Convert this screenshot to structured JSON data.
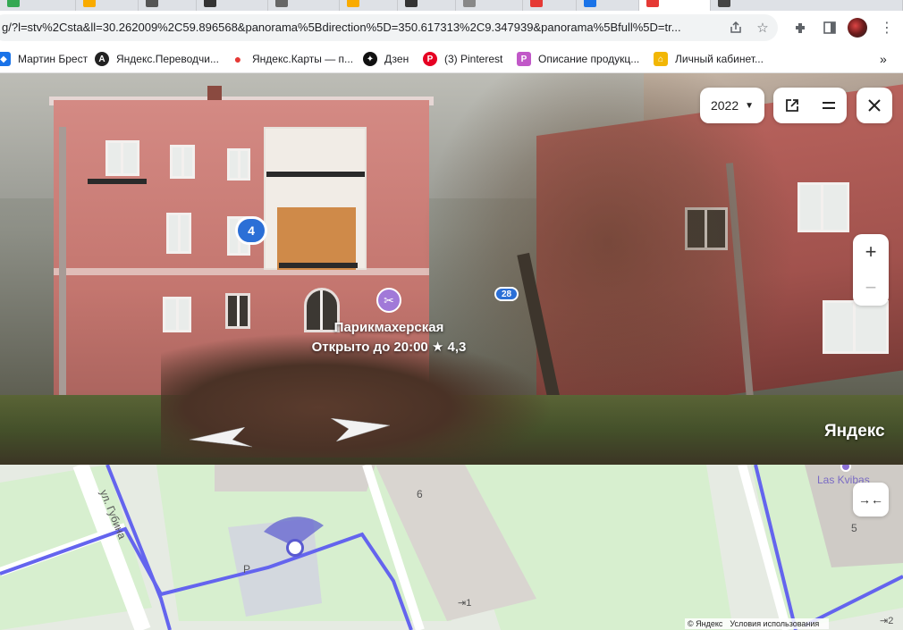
{
  "browser": {
    "url": "g/?l=stv%2Csta&ll=30.262009%2C59.896568&panorama%5Bdirection%5D=350.617313%2C9.347939&panorama%5Bfull%5D=tr...",
    "bookmarks": [
      {
        "label": "Мартин Брест",
        "icon": "bookmark-blue-icon",
        "color": "#1a73e8"
      },
      {
        "label": "Яндекс.Переводчи...",
        "icon": "translate-icon",
        "color": "#222222"
      },
      {
        "label": "Яндекс.Карты — п...",
        "icon": "map-pin-icon",
        "color": "#e53935"
      },
      {
        "label": "Дзен",
        "icon": "zen-icon",
        "color": "#111111"
      },
      {
        "label": "(3) Pinterest",
        "icon": "pinterest-icon",
        "color": "#e60023"
      },
      {
        "label": "Описание продукц...",
        "icon": "p-letter-icon",
        "color": "#c158c8"
      },
      {
        "label": "Личный кабинет...",
        "icon": "home-icon",
        "color": "#f2b705"
      }
    ],
    "overflow": "»"
  },
  "panorama": {
    "year": "2022",
    "cluster_count": "4",
    "house_number": "28",
    "poi": {
      "name": "Парикмахерская",
      "info": "Открыто до 20:00 ★ 4,3"
    },
    "brand": "Яндекс"
  },
  "map": {
    "labels": {
      "street": "ул. Губина",
      "parking": "P",
      "building_6": "6",
      "building_5": "5",
      "entrance_1": "1",
      "entrance_2": "2",
      "place": "Las Kvibas"
    },
    "copyright": "© Яндекс",
    "terms": "Условия использования"
  },
  "colors": {
    "accent": "#2b6fd6",
    "poi": "#a179d8",
    "route": "#5c5cf0"
  }
}
